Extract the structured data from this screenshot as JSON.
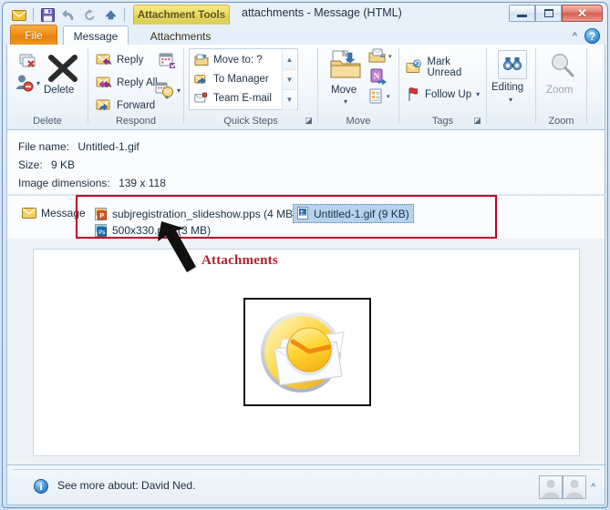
{
  "window": {
    "title": "attachments  -  Message (HTML)",
    "contextual_tab_header": "Attachment Tools",
    "controls": {
      "minimize": "minimize-button",
      "restore": "restore-button",
      "close": "close-button"
    }
  },
  "quick_access_toolbar": {
    "items": [
      {
        "name": "outlook-envelope-icon",
        "label": "Outlook"
      },
      {
        "name": "save-icon",
        "label": "Save"
      },
      {
        "name": "undo-icon",
        "label": "Undo"
      },
      {
        "name": "redo-icon",
        "label": "Redo"
      },
      {
        "name": "previous-item-icon",
        "label": "Previous Item"
      },
      {
        "name": "customize-qat-icon",
        "label": "Customize Quick Access Toolbar"
      }
    ]
  },
  "tabs": [
    {
      "id": "file",
      "label": "File",
      "active": false
    },
    {
      "id": "message",
      "label": "Message",
      "active": true
    },
    {
      "id": "attachments",
      "label": "Attachments",
      "active": false
    }
  ],
  "ribbon_right": {
    "collapse": "^",
    "help": "?"
  },
  "ribbon": {
    "groups": [
      {
        "name": "delete",
        "label": "Delete",
        "buttons": [
          {
            "name": "ignore-button",
            "label": ""
          },
          {
            "name": "junk-button",
            "label": ""
          },
          {
            "name": "delete-button",
            "label": "Delete"
          }
        ]
      },
      {
        "name": "respond",
        "label": "Respond",
        "buttons": [
          {
            "name": "reply-button",
            "label": "Reply"
          },
          {
            "name": "reply-all-button",
            "label": "Reply All"
          },
          {
            "name": "forward-button",
            "label": "Forward"
          },
          {
            "name": "meeting-button",
            "label": ""
          },
          {
            "name": "more-respond-button",
            "label": ""
          }
        ]
      },
      {
        "name": "quick-steps",
        "label": "Quick Steps",
        "items": [
          {
            "name": "quick-step-move-to",
            "label": "Move to: ?"
          },
          {
            "name": "quick-step-to-manager",
            "label": "To Manager"
          },
          {
            "name": "quick-step-team-email",
            "label": "Team E-mail"
          }
        ]
      },
      {
        "name": "move",
        "label": "Move",
        "buttons": [
          {
            "name": "move-button",
            "label": "Move"
          },
          {
            "name": "rules-button",
            "label": ""
          },
          {
            "name": "onenote-button",
            "label": ""
          },
          {
            "name": "actions-button",
            "label": ""
          }
        ]
      },
      {
        "name": "tags",
        "label": "Tags",
        "buttons": [
          {
            "name": "mark-unread-button",
            "label": "Mark Unread"
          },
          {
            "name": "follow-up-button",
            "label": "Follow Up"
          }
        ]
      },
      {
        "name": "editing",
        "label": "",
        "buttons": [
          {
            "name": "editing-button",
            "label": "Editing"
          }
        ]
      },
      {
        "name": "zoom",
        "label": "Zoom",
        "buttons": [
          {
            "name": "zoom-button",
            "label": "Zoom",
            "disabled": true
          }
        ]
      }
    ]
  },
  "info_panel": {
    "rows": [
      {
        "label": "File name:",
        "value": "Untitled-1.gif"
      },
      {
        "label": "Size:",
        "value": "9 KB"
      },
      {
        "label": "Image dimensions:",
        "value": "139 x 118"
      }
    ]
  },
  "attachment_bar": {
    "message_tab_label": "Message",
    "attachments": [
      {
        "name": "attachment-subjregistration-slideshow",
        "label": "subjregistration_slideshow.pps (4 MB)",
        "icon": "powerpoint-show-icon",
        "selected": false
      },
      {
        "name": "attachment-untitled-1-gif",
        "label": "Untitled-1.gif (9 KB)",
        "icon": "gif-image-icon",
        "selected": true
      },
      {
        "name": "attachment-500x330-psd",
        "label": "500x330.psd (3 MB)",
        "icon": "photoshop-icon",
        "selected": false
      }
    ]
  },
  "annotation": {
    "label": "Attachments",
    "box_color": "#c00024",
    "text_color": "#b02030"
  },
  "body": {
    "image_name": "outlook-express-logo-image"
  },
  "status_bar": {
    "text": "See more about: David Ned.",
    "info_icon": "i",
    "people_pane_chevron": "^"
  }
}
